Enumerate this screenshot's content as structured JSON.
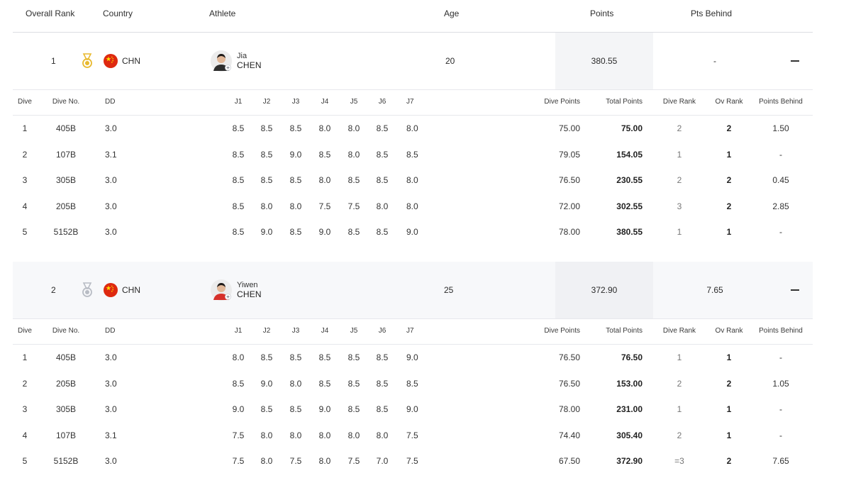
{
  "header": {
    "overall_rank": "Overall Rank",
    "country": "Country",
    "athlete": "Athlete",
    "age": "Age",
    "points": "Points",
    "pts_behind": "Pts Behind"
  },
  "dive_columns": [
    "Dive",
    "Dive No.",
    "DD",
    "J1",
    "J2",
    "J3",
    "J4",
    "J5",
    "J6",
    "J7",
    "Dive Points",
    "Total Points",
    "Dive Rank",
    "Ov Rank",
    "Points Behind"
  ],
  "athletes": [
    {
      "rank": "1",
      "medal": "gold-medal-icon",
      "country": "CHN",
      "first_name": "Jia",
      "last_name": "CHEN",
      "age": "20",
      "points": "380.55",
      "pts_behind": "-",
      "dives": [
        [
          "1",
          "405B",
          "3.0",
          "8.5",
          "8.5",
          "8.5",
          "8.0",
          "8.0",
          "8.5",
          "8.0",
          "75.00",
          "75.00",
          "2",
          "2",
          "1.50"
        ],
        [
          "2",
          "107B",
          "3.1",
          "8.5",
          "8.5",
          "9.0",
          "8.5",
          "8.0",
          "8.5",
          "8.5",
          "79.05",
          "154.05",
          "1",
          "1",
          "-"
        ],
        [
          "3",
          "305B",
          "3.0",
          "8.5",
          "8.5",
          "8.5",
          "8.0",
          "8.5",
          "8.5",
          "8.0",
          "76.50",
          "230.55",
          "2",
          "2",
          "0.45"
        ],
        [
          "4",
          "205B",
          "3.0",
          "8.5",
          "8.0",
          "8.0",
          "7.5",
          "7.5",
          "8.0",
          "8.0",
          "72.00",
          "302.55",
          "3",
          "2",
          "2.85"
        ],
        [
          "5",
          "5152B",
          "3.0",
          "8.5",
          "9.0",
          "8.5",
          "9.0",
          "8.5",
          "8.5",
          "9.0",
          "78.00",
          "380.55",
          "1",
          "1",
          "-"
        ]
      ]
    },
    {
      "rank": "2",
      "medal": "silver-medal-icon",
      "country": "CHN",
      "first_name": "Yiwen",
      "last_name": "CHEN",
      "age": "25",
      "points": "372.90",
      "pts_behind": "7.65",
      "dives": [
        [
          "1",
          "405B",
          "3.0",
          "8.0",
          "8.5",
          "8.5",
          "8.5",
          "8.5",
          "8.5",
          "9.0",
          "76.50",
          "76.50",
          "1",
          "1",
          "-"
        ],
        [
          "2",
          "205B",
          "3.0",
          "8.5",
          "9.0",
          "8.0",
          "8.5",
          "8.5",
          "8.5",
          "8.5",
          "76.50",
          "153.00",
          "2",
          "2",
          "1.05"
        ],
        [
          "3",
          "305B",
          "3.0",
          "9.0",
          "8.5",
          "8.5",
          "9.0",
          "8.5",
          "8.5",
          "9.0",
          "78.00",
          "231.00",
          "1",
          "1",
          "-"
        ],
        [
          "4",
          "107B",
          "3.1",
          "7.5",
          "8.0",
          "8.0",
          "8.0",
          "8.0",
          "8.0",
          "7.5",
          "74.40",
          "305.40",
          "2",
          "1",
          "-"
        ],
        [
          "5",
          "5152B",
          "3.0",
          "7.5",
          "8.0",
          "7.5",
          "8.0",
          "7.5",
          "7.0",
          "7.5",
          "67.50",
          "372.90",
          "=3",
          "2",
          "7.65"
        ]
      ]
    }
  ],
  "colors": {
    "gold": "#e8b92f",
    "silver": "#b8bcc4",
    "flag_red": "#de2910",
    "flag_star": "#ffde00"
  }
}
